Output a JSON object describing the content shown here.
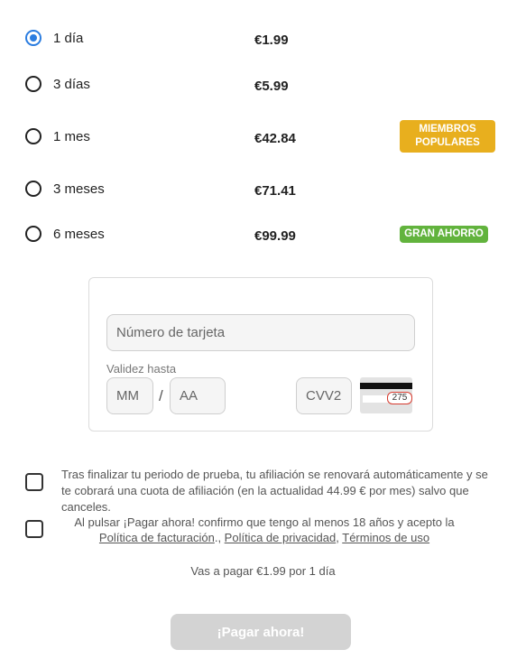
{
  "plans": [
    {
      "label": "1 día",
      "price": "€1.99",
      "selected": true
    },
    {
      "label": "3 días",
      "price": "€5.99"
    },
    {
      "label": "1 mes",
      "price": "€42.84",
      "badge": "MIEMBROS POPULARES"
    },
    {
      "label": "3 meses",
      "price": "€71.41"
    },
    {
      "label": "6 meses",
      "price": "€99.99",
      "badge": "GRAN AHORRO"
    }
  ],
  "badge_colors": {
    "popular": "#e8af1e",
    "saving": "#62b33d"
  },
  "accent_color": "#2b7de0",
  "card_form": {
    "card_number_placeholder": "Número de tarjeta",
    "expiry_label": "Validez hasta",
    "month_placeholder": "MM",
    "separator": "/",
    "year_placeholder": "AA",
    "cvv_placeholder": "CVV2",
    "cvv_example": "275"
  },
  "terms": {
    "renewal_text": "Tras finalizar tu periodo de prueba, tu afiliación se renovará automáticamente y se te cobrará una cuota de afiliación (en la actualidad 44.99 € por mes) salvo que canceles.",
    "confirm_text": "Al pulsar ¡Pagar ahora! confirmo que tengo al menos 18 años y acepto la",
    "billing_policy": "Política de facturación",
    "privacy_policy": "Política de privacidad",
    "terms_of_use": "Términos de uso"
  },
  "summary": "Vas a pagar €1.99 por 1 día",
  "pay_button": "¡Pagar ahora!"
}
